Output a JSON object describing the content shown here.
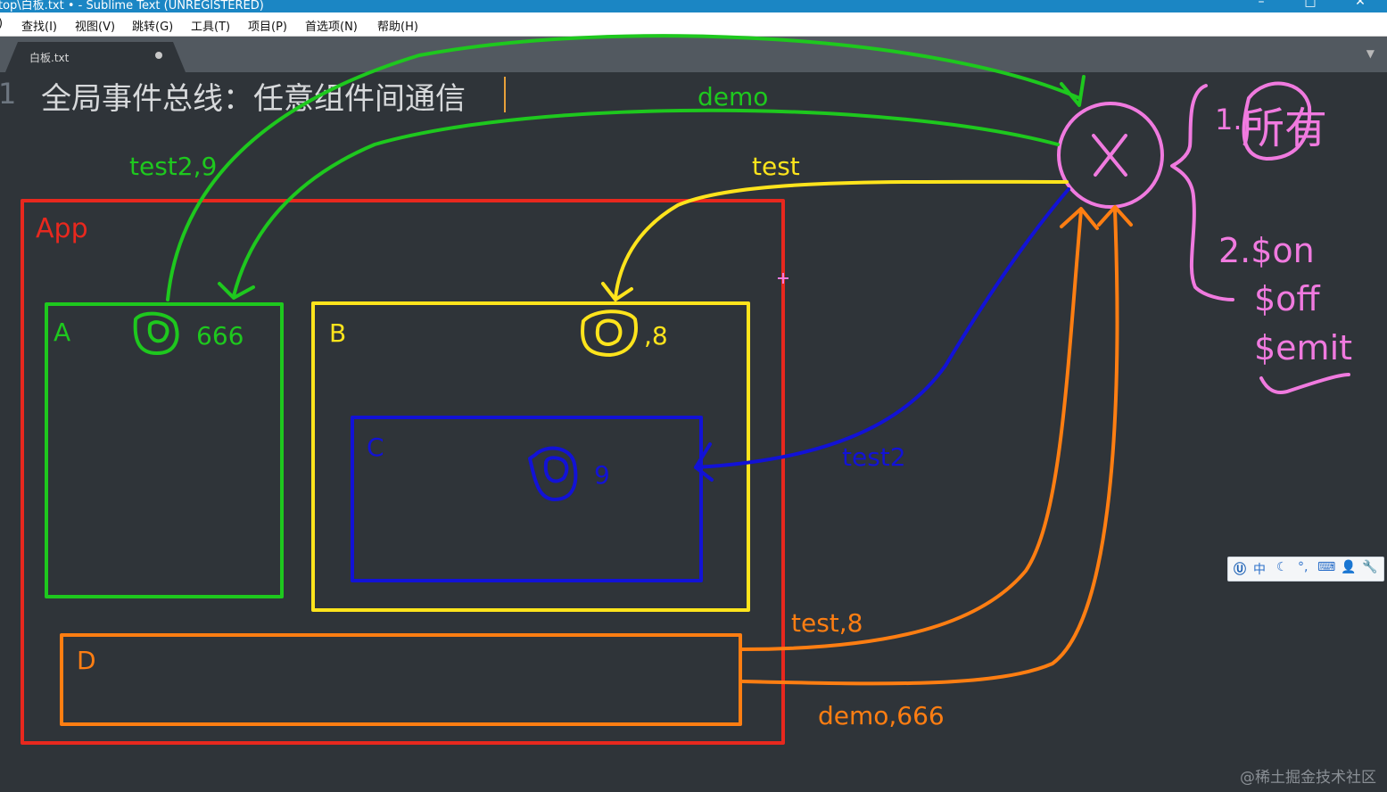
{
  "window": {
    "title": "top\\白板.txt • - Sublime Text (UNREGISTERED)",
    "controls": [
      "–",
      "□",
      "✕"
    ]
  },
  "menu": [
    {
      "label": ")"
    },
    {
      "label": "查找(I)"
    },
    {
      "label": "视图(V)"
    },
    {
      "label": "跳转(G)"
    },
    {
      "label": "工具(T)"
    },
    {
      "label": "项目(P)"
    },
    {
      "label": "首选项(N)"
    },
    {
      "label": "帮助(H)"
    }
  ],
  "tab": {
    "label": "白板.txt",
    "dropdown": "▼"
  },
  "editor": {
    "line_number": "1",
    "line_text": "全局事件总线：任意组件间通信"
  },
  "annotations": {
    "app_label": "App",
    "a_label": "A",
    "a_value": "666",
    "b_label": "B",
    "b_value": ",8",
    "c_label": "C",
    "c_value": "9",
    "d_label": "D",
    "bus_symbol": "X",
    "arrow_demo": "demo",
    "arrow_test": "test",
    "arrow_test2_9": "test2,9",
    "arrow_test2": "test2",
    "arrow_test_8": "test,8",
    "arrow_demo_666": "demo,666",
    "note_1": "1.",
    "note_1_word": "所有",
    "note_2": "2.$on",
    "note_off": "$off",
    "note_emit": "$emit"
  },
  "colors": {
    "green": "#1ec81e",
    "yellow": "#ffe41c",
    "blue": "#1212d6",
    "red": "#e8281e",
    "orange": "#ff7e12",
    "pink": "#f07adf"
  },
  "ime": {
    "items": [
      "中",
      "☾",
      "°,",
      "⌨",
      "👤",
      "🔧"
    ]
  },
  "watermark": "@稀土掘金技术社区"
}
